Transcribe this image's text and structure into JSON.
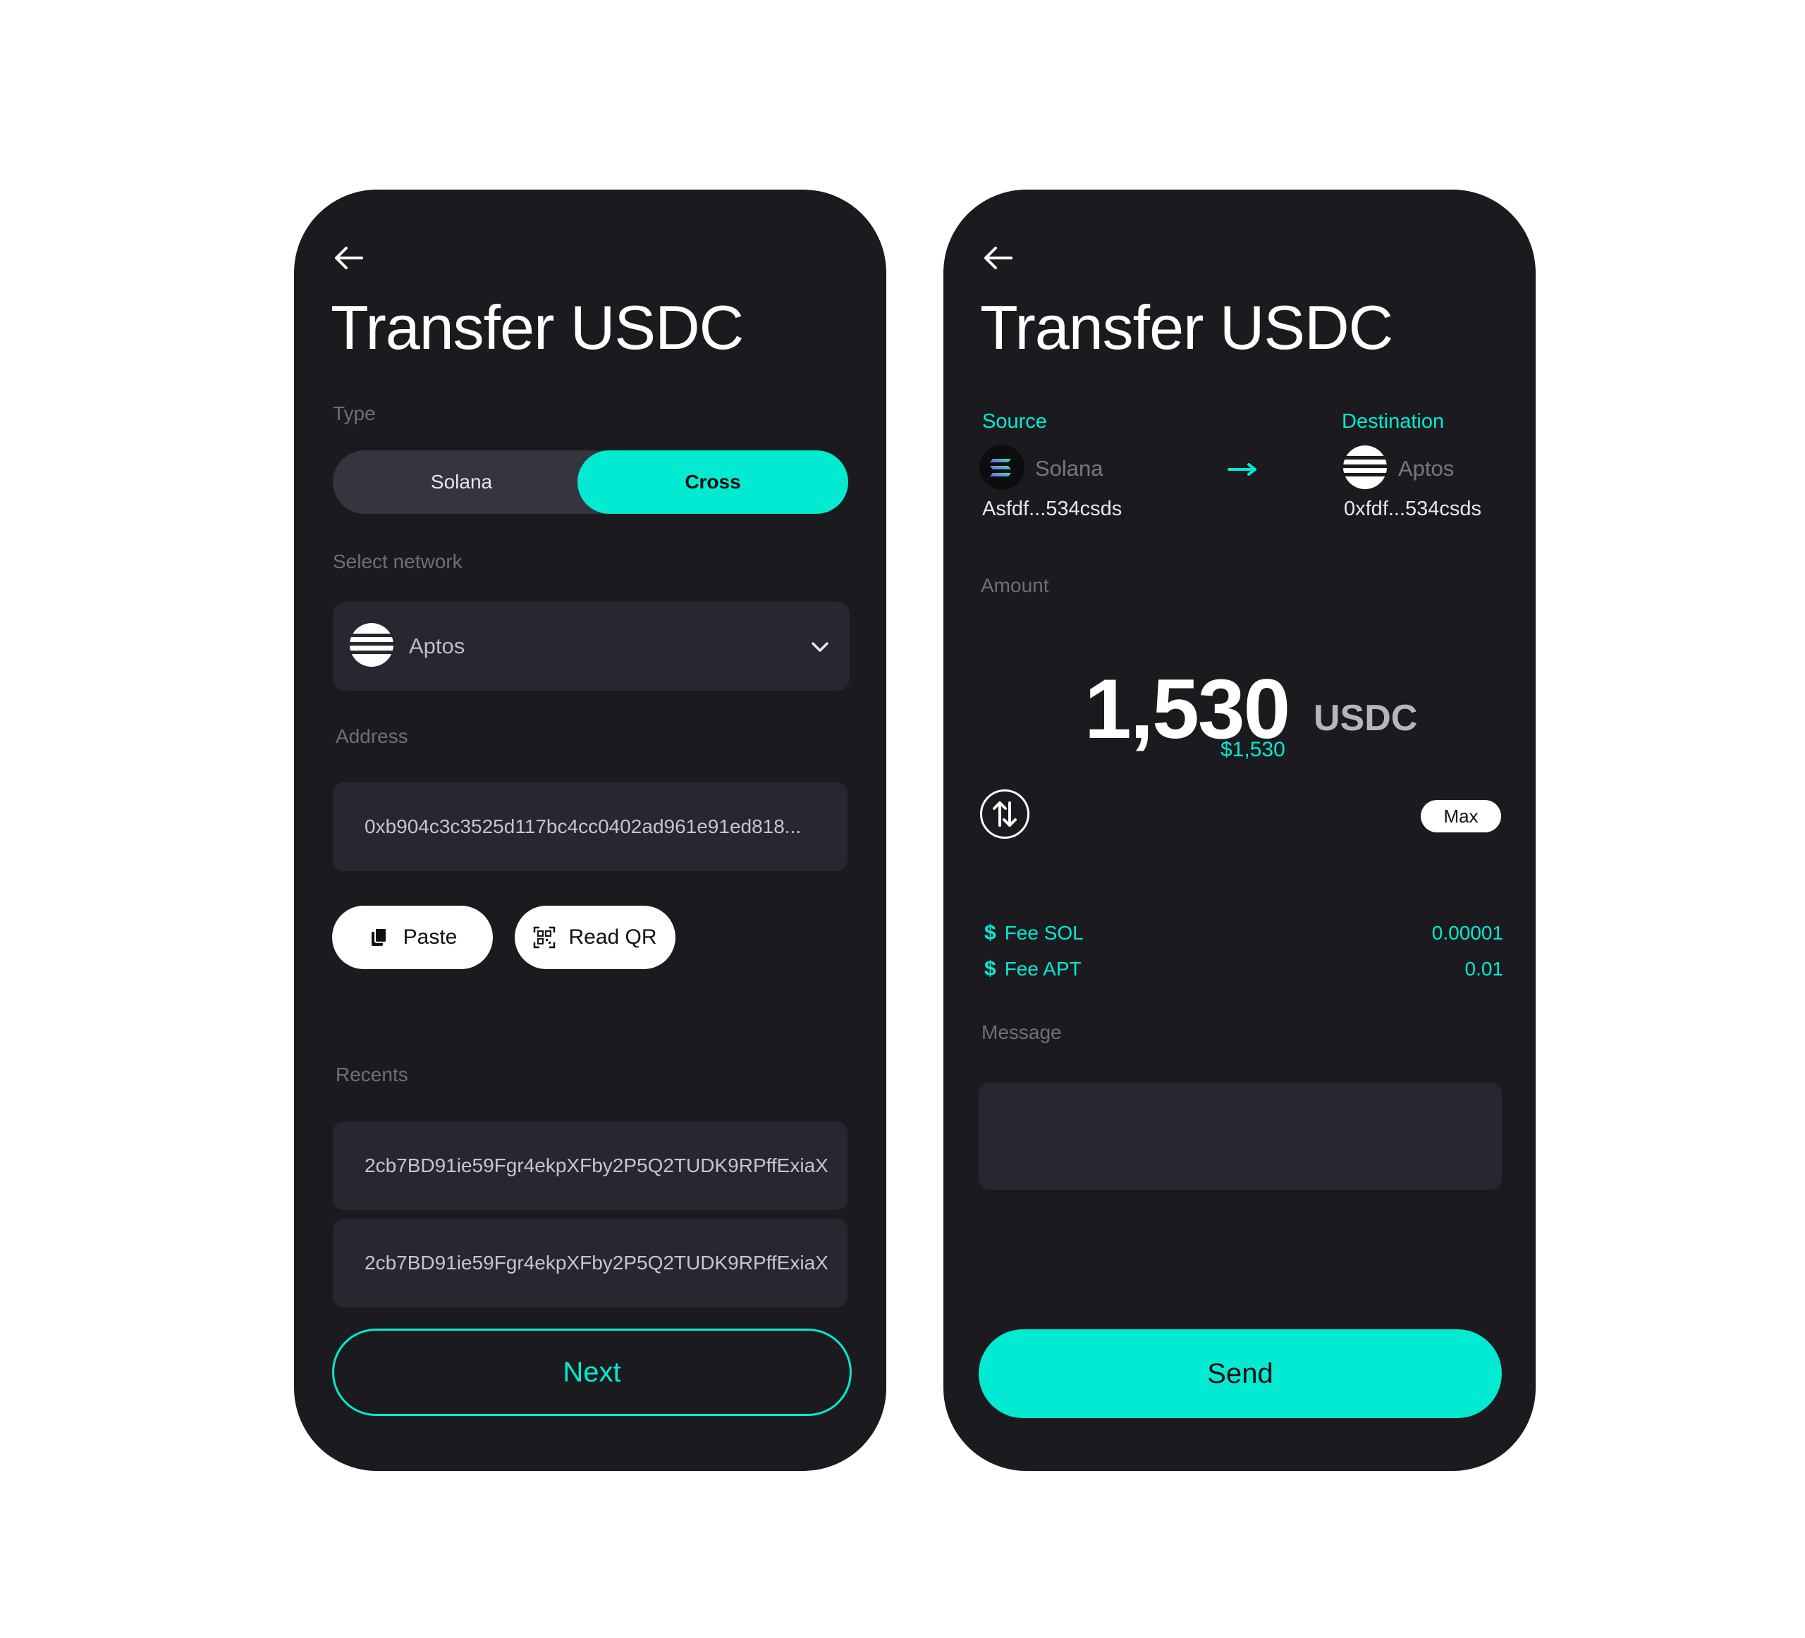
{
  "left": {
    "title": "Transfer USDC",
    "type_label": "Type",
    "type_options": [
      "Solana",
      "Cross"
    ],
    "type_selected": "Cross",
    "network_label": "Select network",
    "network_value": "Aptos",
    "network_icon": "aptos-logo",
    "address_label": "Address",
    "address_value": "0xb904c3c3525d117bc4cc0402ad961e91ed818...",
    "paste_label": "Paste",
    "read_qr_label": "Read QR",
    "recents_label": "Recents",
    "recents": [
      "2cb7BD91ie59Fgr4ekpXFby2P5Q2TUDK9RPffExiaX",
      "2cb7BD91ie59Fgr4ekpXFby2P5Q2TUDK9RPffExiaX"
    ],
    "next_label": "Next"
  },
  "right": {
    "title": "Transfer USDC",
    "source_label": "Source",
    "source_network": "Solana",
    "source_address": "Asfdf...534csds",
    "destination_label": "Destination",
    "destination_network": "Aptos",
    "destination_address": "0xfdf...534csds",
    "amount_label": "Amount",
    "amount_value": "1,530",
    "amount_unit": "USDC",
    "amount_fiat": "$1,530",
    "max_label": "Max",
    "fees": [
      {
        "label": "Fee SOL",
        "value": "0.00001"
      },
      {
        "label": "Fee APT",
        "value": "0.01"
      }
    ],
    "message_label": "Message",
    "message_value": "",
    "send_label": "Send"
  },
  "colors": {
    "accent": "#02ebd2",
    "panel": "#1b1b1f",
    "field": "#272730",
    "muted_text": "#6e6f76"
  }
}
